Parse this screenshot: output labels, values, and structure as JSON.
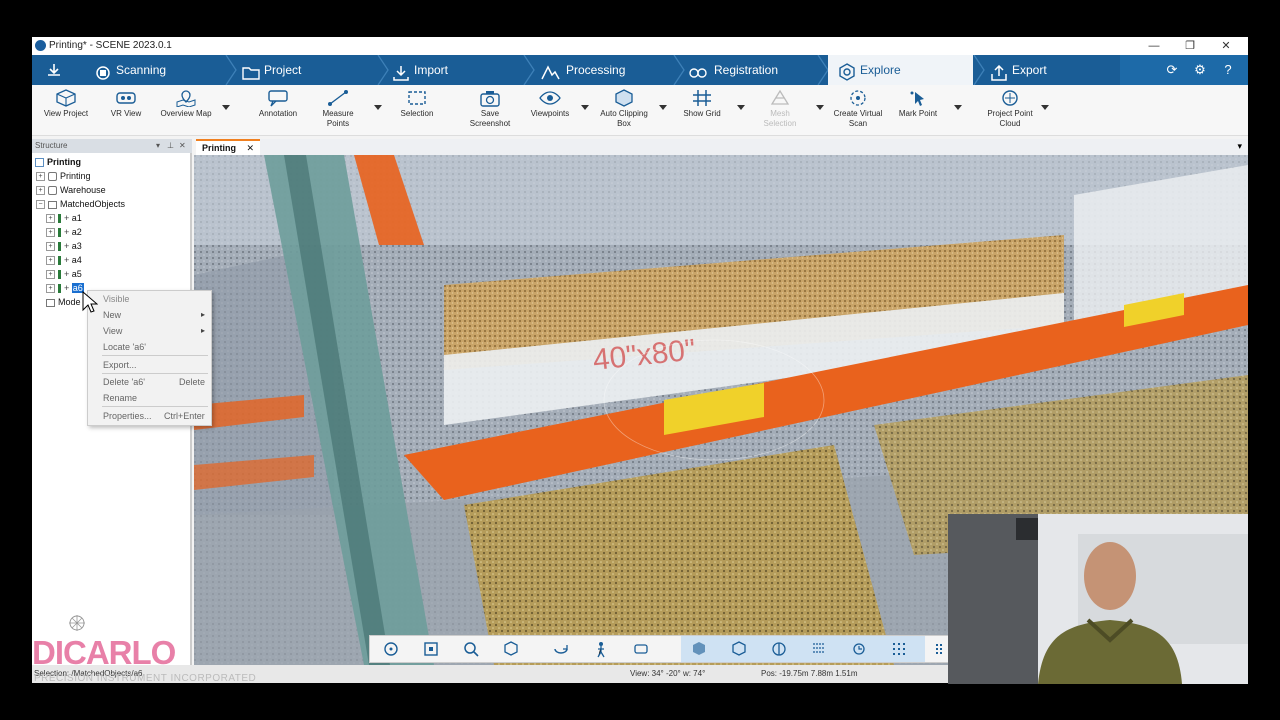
{
  "window": {
    "title": "Printing* - SCENE 2023.0.1",
    "controls": {
      "minimize": "—",
      "maximize": "❐",
      "close": "✕"
    }
  },
  "tabs": [
    {
      "label": "Scanning",
      "icon": "scanner-icon"
    },
    {
      "label": "Project",
      "icon": "folder-icon"
    },
    {
      "label": "Import",
      "icon": "import-icon"
    },
    {
      "label": "Processing",
      "icon": "processing-icon"
    },
    {
      "label": "Registration",
      "icon": "registration-icon"
    },
    {
      "label": "Explore",
      "icon": "explore-icon",
      "active": true
    },
    {
      "label": "Export",
      "icon": "export-icon"
    }
  ],
  "ribbon": {
    "view_project": "View Project",
    "vr_view": "VR View",
    "overview_map": "Overview Map",
    "annotation": "Annotation",
    "measure_points_1": "Measure",
    "measure_points_2": "Points",
    "selection": "Selection",
    "save_screenshot_1": "Save",
    "save_screenshot_2": "Screenshot",
    "viewpoints": "Viewpoints",
    "auto_clipping_1": "Auto Clipping",
    "auto_clipping_2": "Box",
    "show_grid": "Show Grid",
    "mesh_selection_1": "Mesh",
    "mesh_selection_2": "Selection",
    "create_virtual_1": "Create Virtual",
    "create_virtual_2": "Scan",
    "mark_point": "Mark Point",
    "project_point_1": "Project Point",
    "project_point_2": "Cloud"
  },
  "structure": {
    "header": "Structure",
    "items": [
      {
        "label": "Printing"
      },
      {
        "label": "Printing"
      },
      {
        "label": "Warehouse"
      },
      {
        "label": "MatchedObjects"
      },
      {
        "label": "a1"
      },
      {
        "label": "a2"
      },
      {
        "label": "a3"
      },
      {
        "label": "a4"
      },
      {
        "label": "a5"
      },
      {
        "label": "a6"
      },
      {
        "label": "Mode"
      }
    ]
  },
  "context_menu": {
    "visible": "Visible",
    "new": "New",
    "view": "View",
    "locate": "Locate 'a6'",
    "export": "Export...",
    "delete": "Delete 'a6'",
    "delete_shortcut": "Delete",
    "rename": "Rename",
    "properties": "Properties...",
    "properties_shortcut": "Ctrl+Enter"
  },
  "viewport": {
    "tab_label": "Printing",
    "scene_text": "40\"x80\""
  },
  "status": {
    "selection": "Selection: /MatchedObjects/a6",
    "view": "View: 34° -20° w: 74°",
    "pos": "Pos: -19.75m 7.88m 1.51m"
  },
  "watermark": {
    "brand": "DICARLO",
    "tagline": "PRECISION INSTRUMENT INCORPORATED"
  },
  "colors": {
    "tabbar": "#1a5d96",
    "accent_orange": "#f08020",
    "selection_blue": "#1a6fd0"
  }
}
